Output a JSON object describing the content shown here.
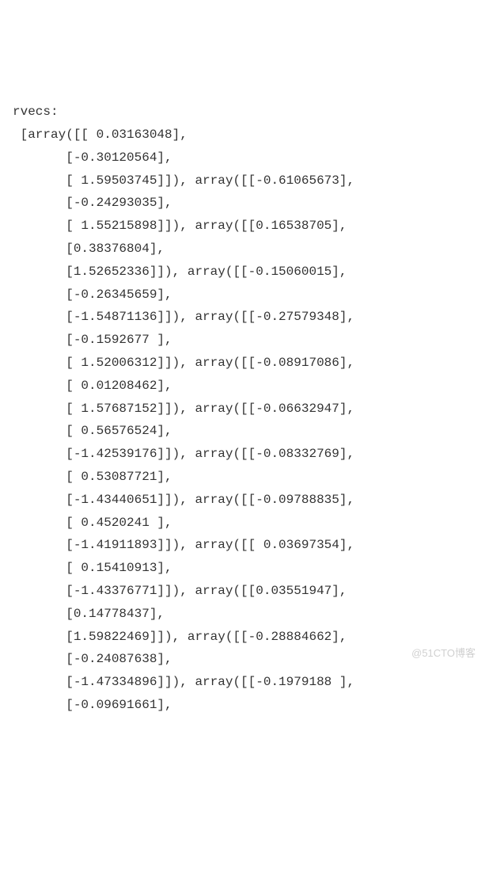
{
  "header": "rvecs:",
  "lines": [
    " [array([[ 0.03163048],",
    "       [-0.30120564],",
    "       [ 1.59503745]]), array([[-0.61065673],",
    "       [-0.24293035],",
    "       [ 1.55215898]]), array([[0.16538705],",
    "       [0.38376804],",
    "       [1.52652336]]), array([[-0.15060015],",
    "       [-0.26345659],",
    "       [-1.54871136]]), array([[-0.27579348],",
    "       [-0.1592677 ],",
    "       [ 1.52006312]]), array([[-0.08917086],",
    "       [ 0.01208462],",
    "       [ 1.57687152]]), array([[-0.06632947],",
    "       [ 0.56576524],",
    "       [-1.42539176]]), array([[-0.08332769],",
    "       [ 0.53087721],",
    "       [-1.43440651]]), array([[-0.09788835],",
    "       [ 0.4520241 ],",
    "       [-1.41911893]]), array([[ 0.03697354],",
    "       [ 0.15410913],",
    "       [-1.43376771]]), array([[0.03551947],",
    "       [0.14778437],",
    "       [1.59822469]]), array([[-0.28884662],",
    "       [-0.24087638],",
    "       [-1.47334896]]), array([[-0.1979188 ],",
    "       [-0.09691661],"
  ],
  "watermark": "@51CTO博客"
}
